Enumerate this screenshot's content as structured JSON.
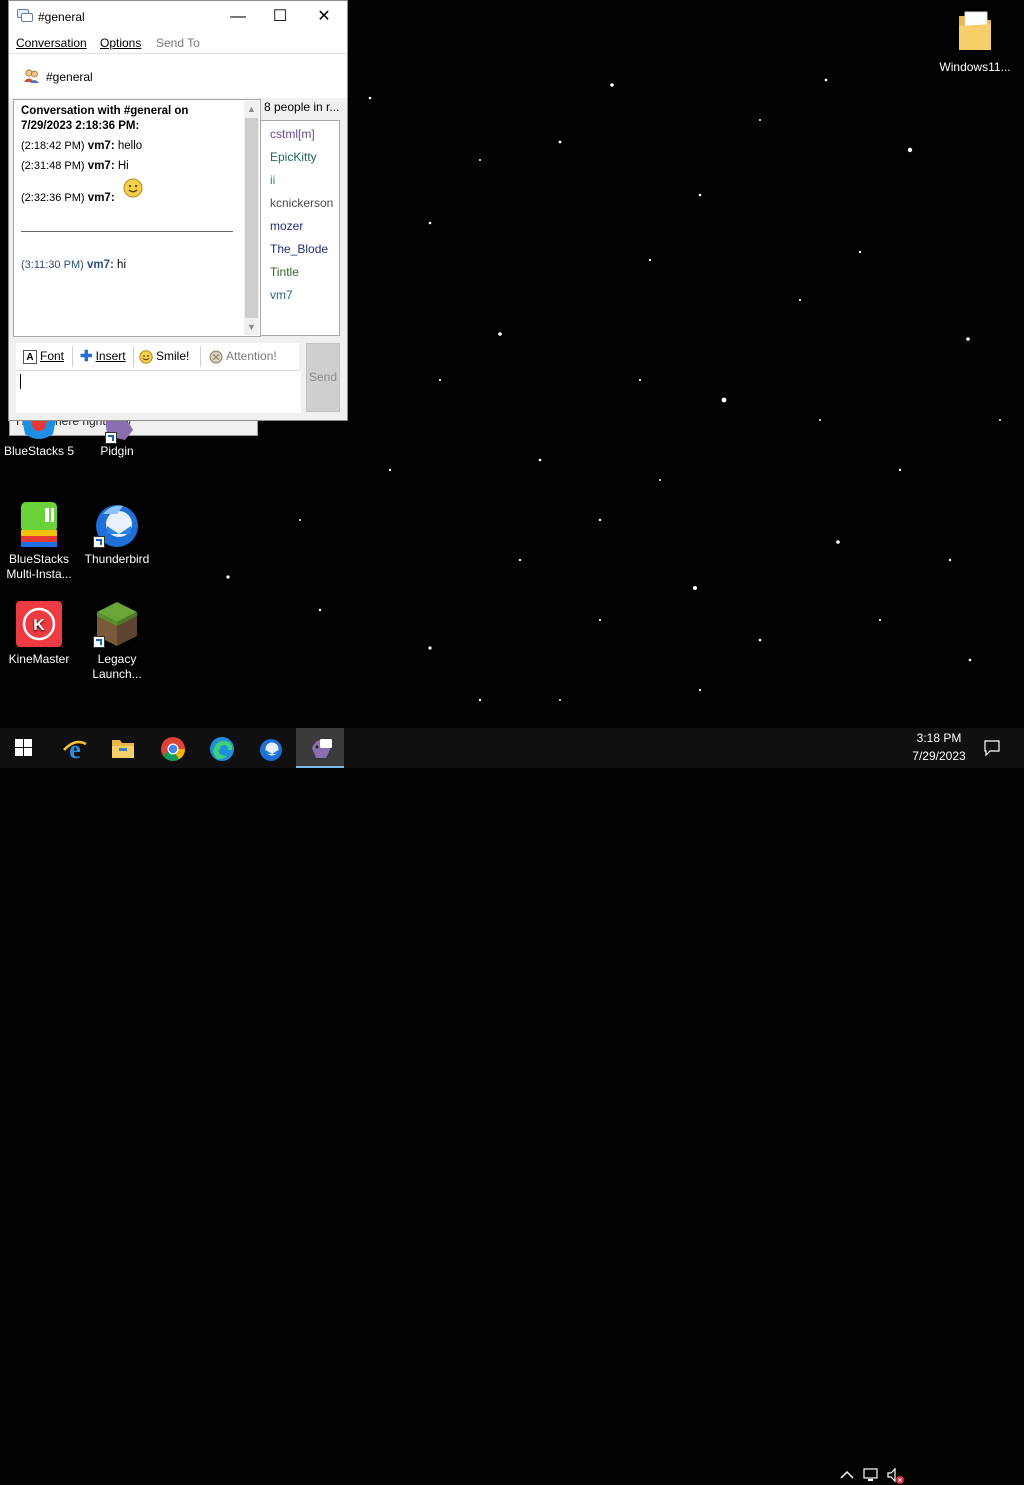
{
  "window": {
    "title": "#general",
    "controls": {
      "minimize": "—",
      "maximize": "☐",
      "close": "✕"
    }
  },
  "menu": [
    {
      "label": "Conversation",
      "disabled": false
    },
    {
      "label": "Options",
      "disabled": false
    },
    {
      "label": "Send To",
      "disabled": true
    }
  ],
  "conversation_header": {
    "name": "#general"
  },
  "log": {
    "header_line1": "Conversation with #general on",
    "header_line2": "7/29/2023 2:18:36 PM:",
    "messages": [
      {
        "time": "(2:18:42 PM)",
        "sender": "vm7:",
        "text": "hello"
      },
      {
        "time": "(2:31:48 PM)",
        "sender": "vm7:",
        "text": "Hi"
      },
      {
        "time": "(2:32:36 PM)",
        "sender": "vm7:",
        "text": ""
      },
      {
        "time": "(3:11:30 PM)",
        "sender": "vm7:",
        "text": "hi"
      }
    ]
  },
  "people": {
    "count_label": "8 people in r...",
    "users": [
      {
        "name": "cstml[m]",
        "color": "#6b4a8a"
      },
      {
        "name": "EpicKitty",
        "color": "#1e6a63"
      },
      {
        "name": "ii",
        "color": "#3a7a8a"
      },
      {
        "name": "kcnickerson",
        "color": "#4b4b4b"
      },
      {
        "name": "mozer",
        "color": "#1f2f7a"
      },
      {
        "name": "The_Blode",
        "color": "#1f2f7a"
      },
      {
        "name": "Tintle",
        "color": "#2e6b2e"
      },
      {
        "name": "vm7",
        "color": "#2f5f8a"
      }
    ]
  },
  "toolbar": {
    "font": "Font",
    "insert": "Insert",
    "smile": "Smile!",
    "attention": "Attention!",
    "send": "Send"
  },
  "background_window": {
    "status_text": "I'm not here right now"
  },
  "desktop_icons": {
    "bluestacks5": "BlueStacks 5",
    "pidgin": "Pidgin",
    "bluestacks_multi_1": "BlueStacks",
    "bluestacks_multi_2": "Multi-Insta...",
    "thunderbird": "Thunderbird",
    "kinemaster": "KineMaster",
    "legacy_1": "Legacy",
    "legacy_2": "Launch...",
    "folder": "Windows11..."
  },
  "taskbar": {
    "apps": [
      "start-icon",
      "internet-explorer-icon",
      "file-explorer-icon",
      "chrome-icon",
      "edge-icon",
      "thunderbird-icon",
      "pidgin-icon"
    ],
    "active_app": "pidgin-icon"
  },
  "clock": {
    "time": "3:18 PM",
    "date": "7/29/2023"
  }
}
